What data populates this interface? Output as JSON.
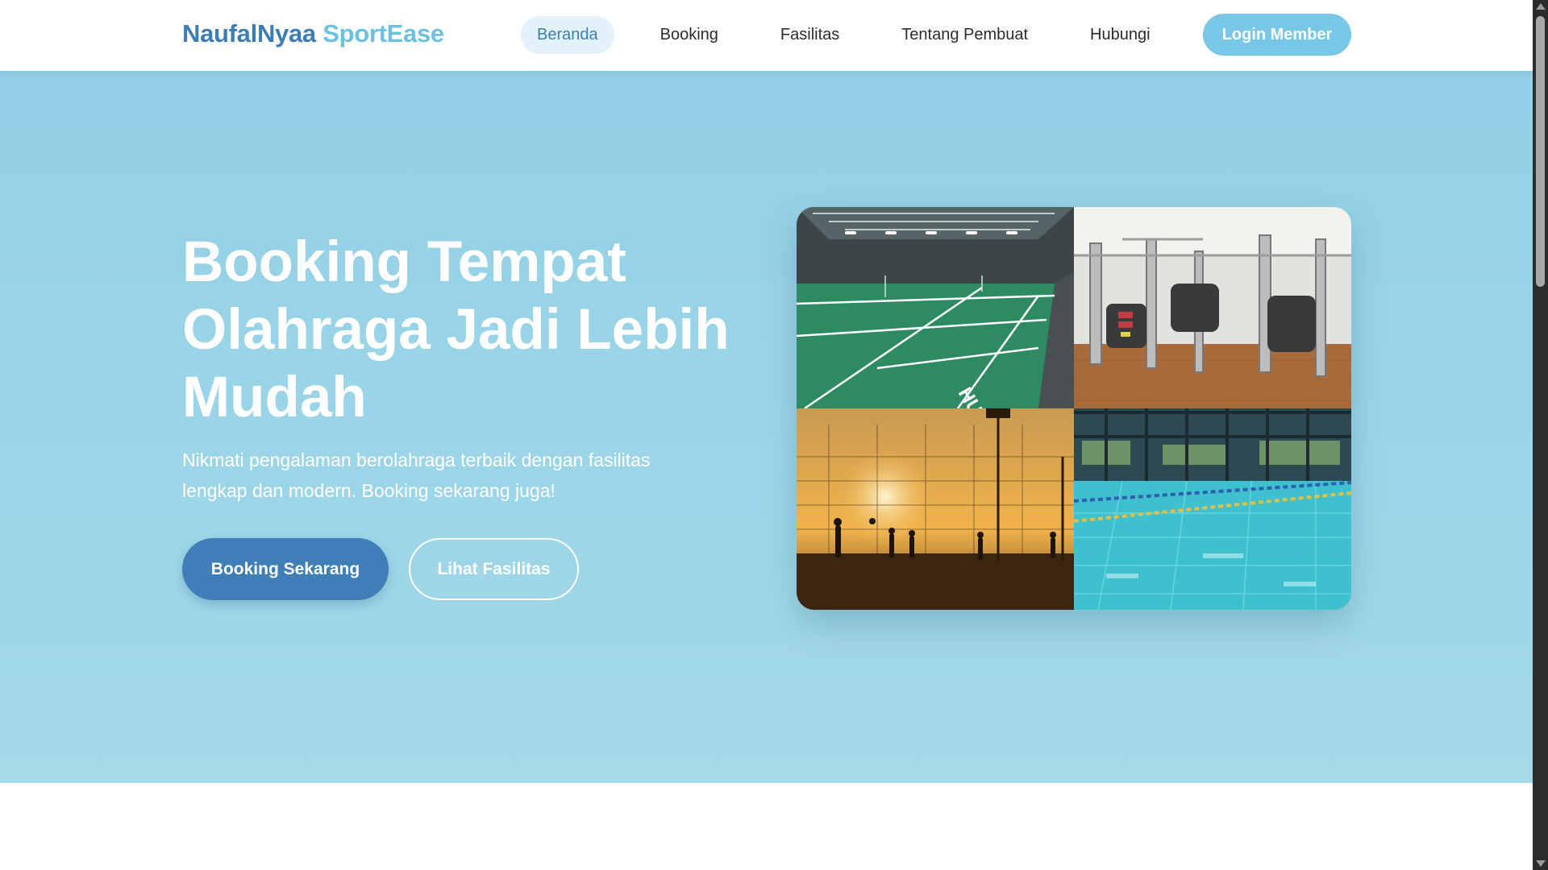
{
  "navbar": {
    "brand_part1": "NaufalNyaa",
    "brand_part2": "SportEase",
    "links": [
      {
        "label": "Beranda",
        "active": true
      },
      {
        "label": "Booking",
        "active": false
      },
      {
        "label": "Fasilitas",
        "active": false
      },
      {
        "label": "Tentang Pembuat",
        "active": false
      },
      {
        "label": "Hubungi",
        "active": false
      }
    ],
    "login_label": "Login Member"
  },
  "hero": {
    "title": "Booking Tempat Olahraga Jadi Lebih Mudah",
    "subtitle": "Nikmati pengalaman berolahraga terbaik dengan fasilitas lengkap dan modern. Booking sekarang juga!",
    "primary_button": "Booking Sekarang",
    "secondary_button": "Lihat Fasilitas"
  },
  "collage": {
    "images": [
      "badminton-court-image",
      "gym-equipment-image",
      "outdoor-court-sunset-image",
      "swimming-pool-image"
    ]
  },
  "colors": {
    "brand_dark": "#3d7db5",
    "brand_light": "#6ec0e3",
    "hero_bg": "#92d0e7",
    "login_bg": "#78c7e6"
  }
}
